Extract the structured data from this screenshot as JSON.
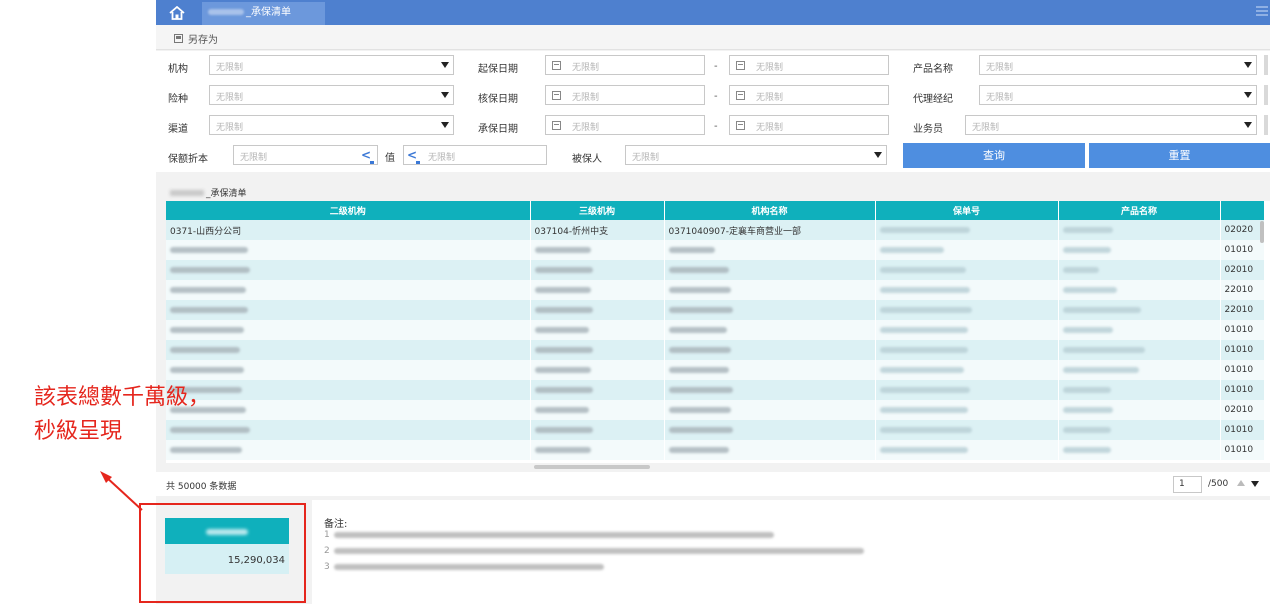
{
  "header": {
    "tab_title": "_承保清单"
  },
  "toolbar": {
    "save_as": "另存为"
  },
  "filters": {
    "org_label": "机构",
    "org_value": "无限制",
    "start_date_label": "起保日期",
    "start_date_from": "无限制",
    "start_date_to": "无限制",
    "product_label": "产品名称",
    "product_value": "无限制",
    "class_label": "险种",
    "class_value": "无限制",
    "sign_date_label": "核保日期",
    "sign_date_from": "无限制",
    "sign_date_to": "无限制",
    "agent_label": "代理经纪",
    "agent_value": "无限制",
    "channel_label": "渠道",
    "channel_value": "无限制",
    "issue_date_label": "承保日期",
    "issue_date_from": "无限制",
    "issue_date_to": "无限制",
    "salesman_label": "业务员",
    "salesman_value": "无限制",
    "premium_label": "保额折本",
    "premium_from": "无限制",
    "premium_to_label": "值",
    "premium_to": "无限制",
    "insured_label": "被保人",
    "insured_value": "无限制",
    "range_sep": "-",
    "cmp_symbol": "<",
    "query_button": "查询",
    "reset_button": "重置"
  },
  "list": {
    "title": "_承保清单",
    "columns": [
      "二级机构",
      "三级机构",
      "机构名称",
      "保单号",
      "产品名称",
      ""
    ],
    "rows": [
      {
        "c1": "0371-山西分公司",
        "c2": "037104-忻州中支",
        "c3": "0371040907-定襄车商营业一部",
        "c6": "02020"
      },
      {
        "c6": "01010"
      },
      {
        "c6": "02010"
      },
      {
        "c6": "22010"
      },
      {
        "c6": "22010"
      },
      {
        "c6": "01010"
      },
      {
        "c6": "01010"
      },
      {
        "c6": "01010"
      },
      {
        "c6": "01010"
      },
      {
        "c6": "02010"
      },
      {
        "c6": "01010"
      },
      {
        "c6": "01010"
      }
    ],
    "count_text": "共 50000 条数据",
    "page_current": "1",
    "page_total": "/500"
  },
  "summary": {
    "kpi_value": "15,290,034",
    "notes_title": "备注:",
    "note_numbers": [
      "1",
      "2",
      "3"
    ]
  },
  "annotation": {
    "line1": "該表總數千萬級，",
    "line2": "秒級呈現",
    "color": "#e5261d"
  },
  "colors": {
    "topbar": "#4e80cf",
    "grid_header": "#0fb0bc",
    "button": "#4e8ee0"
  }
}
